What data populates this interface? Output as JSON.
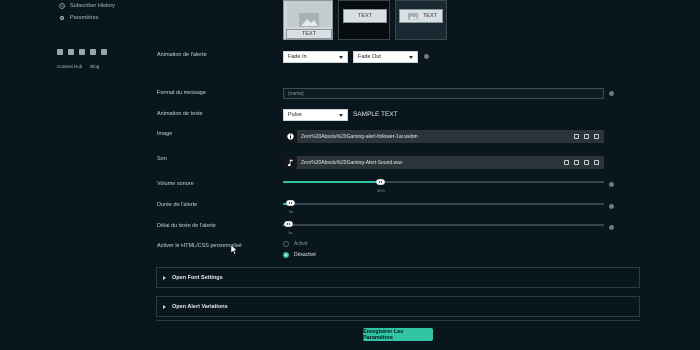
{
  "sidebar": {
    "items": [
      {
        "label": "Subscriber History",
        "icon": "history-icon"
      },
      {
        "label": "Paramètres",
        "icon": "gear-icon"
      }
    ],
    "social_icons": [
      "twitter-icon",
      "youtube-icon",
      "instagram-icon",
      "facebook-icon",
      "discord-icon"
    ],
    "links": [
      "Content Hub",
      "Blog"
    ]
  },
  "layouts": {
    "card1_text": "TEXT",
    "card2_text": "TEXT",
    "card3_text": "TEXT"
  },
  "form": {
    "animation_alert": {
      "label": "Animation de l'alerte",
      "in_value": "Fade In",
      "out_value": "Fade Out"
    },
    "message_format": {
      "label": "Format du message",
      "value": "{name}"
    },
    "text_animation": {
      "label": "Animation de texte",
      "value": "Pulse",
      "sample": "SAMPLE TEXT"
    },
    "image": {
      "label": "Image",
      "file": "Zero%20Absolu%20Gaming-alert-follower-1ar.webm"
    },
    "sound": {
      "label": "Son",
      "file": "Zero%20Absolu%20Gaming-Alert-Sound.wav"
    },
    "volume": {
      "label": "Volume sonore",
      "value_text": "35%",
      "value": 0.35
    },
    "duration": {
      "label": "Durée de l'alerte",
      "value_text": "5s",
      "value": 0.01
    },
    "text_delay": {
      "label": "Délai du texte de l'alerte",
      "value_text": "1s",
      "value": 0.01
    },
    "custom_css": {
      "label": "Activer le HTML/CSS personnalisé",
      "option_on": "Activé",
      "option_off": "Désactivé",
      "selected": "Désactivé"
    }
  },
  "accordions": {
    "font": "Open Font Settings",
    "variations": "Open Alert Variations"
  },
  "save_button": "Enregistrer Les Paramètres",
  "colors": {
    "background": "#09161d",
    "accent": "#31c3a2"
  }
}
